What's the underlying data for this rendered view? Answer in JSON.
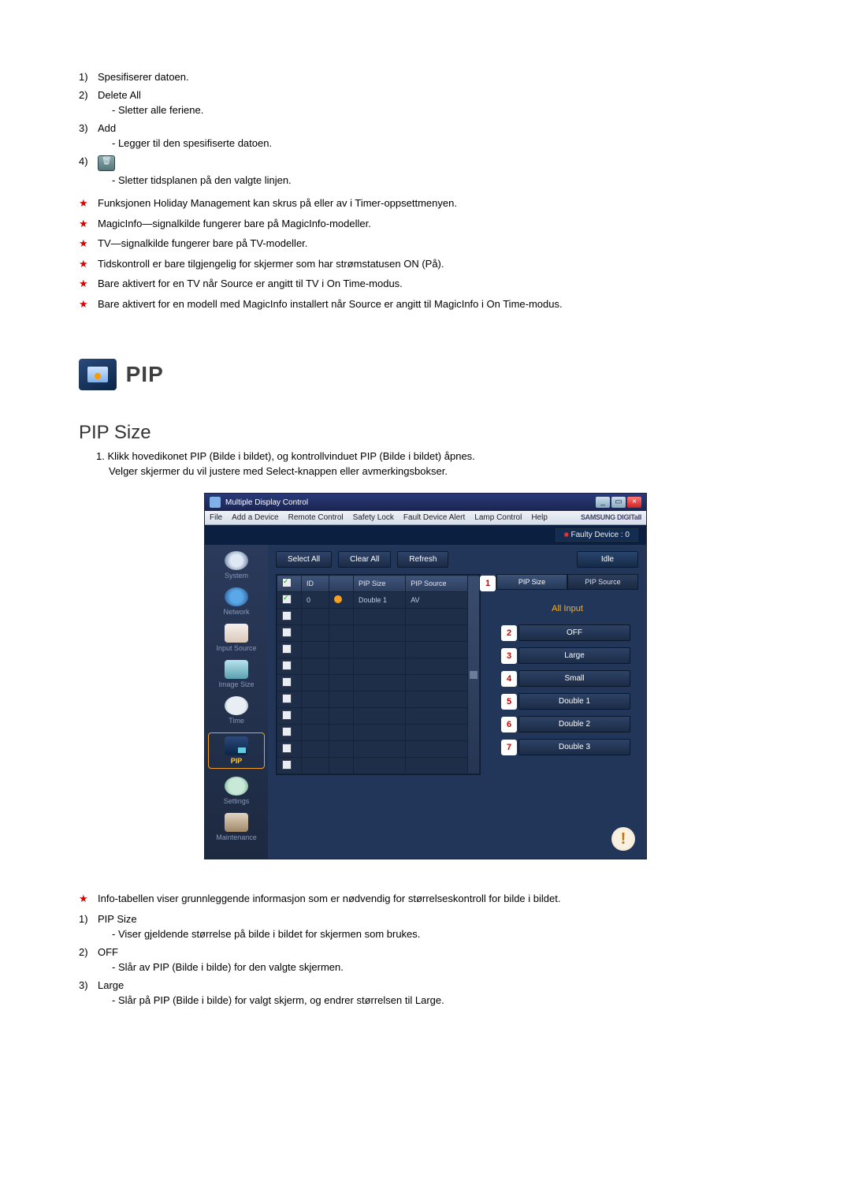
{
  "top_list": [
    {
      "num": "1)",
      "label": "Spesifiserer datoen."
    },
    {
      "num": "2)",
      "label": "Delete All",
      "sub": [
        "Sletter alle feriene."
      ]
    },
    {
      "num": "3)",
      "label": "Add",
      "sub": [
        "Legger til den spesifiserte datoen."
      ]
    },
    {
      "num": "4)",
      "label": "",
      "has_icon": true,
      "sub": [
        "Sletter tidsplanen på den valgte linjen."
      ]
    }
  ],
  "star_notes_top": [
    "Funksjonen Holiday Management kan skrus på eller av i Timer-oppsettmenyen.",
    "MagicInfo—signalkilde fungerer bare på MagicInfo-modeller.",
    "TV—signalkilde fungerer bare på TV-modeller.",
    "Tidskontroll er bare tilgjengelig for skjermer som har strømstatusen ON (På).",
    "Bare aktivert for en TV når Source er angitt til TV i On Time-modus.",
    "Bare aktivert for en modell med MagicInfo installert når Source er angitt til MagicInfo i On Time-modus."
  ],
  "pip_heading": "PIP",
  "subsection_heading": "PIP Size",
  "intro_lines": [
    "1. Klikk hovedikonet PIP (Bilde i bildet), og kontrollvinduet PIP (Bilde i bildet) åpnes.",
    "Velger skjermer du vil justere med Select-knappen eller avmerkingsbokser."
  ],
  "window": {
    "title": "Multiple Display Control",
    "win_buttons": {
      "min": "_",
      "max": "▭",
      "close": "×"
    },
    "menu": [
      "File",
      "Add a Device",
      "Remote Control",
      "Safety Lock",
      "Fault Device Alert",
      "Lamp Control",
      "Help"
    ],
    "brand": "SAMSUNG DIGITall",
    "faulty_label": "Faulty Device : 0",
    "toolbar": {
      "select_all": "Select All",
      "clear_all": "Clear All",
      "refresh": "Refresh",
      "idle": "Idle"
    },
    "sidebar": [
      {
        "cls": "system",
        "label": "System"
      },
      {
        "cls": "network",
        "label": "Network"
      },
      {
        "cls": "input",
        "label": "Input Source"
      },
      {
        "cls": "image",
        "label": "Image Size"
      },
      {
        "cls": "time",
        "label": "Time"
      },
      {
        "cls": "pip",
        "label": "PIP"
      },
      {
        "cls": "settings",
        "label": "Settings"
      },
      {
        "cls": "maint",
        "label": "Maintenance"
      }
    ],
    "table": {
      "headers": {
        "chk": "",
        "id": "ID",
        "status": "",
        "size": "PIP Size",
        "source": "PIP Source"
      },
      "row": {
        "id": "0",
        "size": "Double 1",
        "source": "AV"
      },
      "blank_rows": 10
    },
    "right": {
      "tab_active": "PIP Size",
      "tab_inactive": "PIP Source",
      "all_input": "All Input",
      "options": [
        "OFF",
        "Large",
        "Small",
        "Double 1",
        "Double 2",
        "Double 3"
      ],
      "markers": [
        "1",
        "2",
        "3",
        "4",
        "5",
        "6",
        "7"
      ]
    },
    "alert_glyph": "!"
  },
  "star_notes_bottom": [
    "Info-tabellen viser grunnleggende informasjon som er nødvendig for størrelseskontroll for bilde i bildet."
  ],
  "bottom_list": [
    {
      "num": "1)",
      "label": "PIP Size",
      "sub": [
        "Viser gjeldende størrelse på bilde i bildet for skjermen som brukes."
      ]
    },
    {
      "num": "2)",
      "label": "OFF",
      "sub": [
        "Slår av PIP (Bilde i bilde) for den valgte skjermen."
      ]
    },
    {
      "num": "3)",
      "label": "Large",
      "sub": [
        "Slår på PIP (Bilde i bilde) for valgt skjerm, og endrer størrelsen til Large."
      ]
    }
  ]
}
